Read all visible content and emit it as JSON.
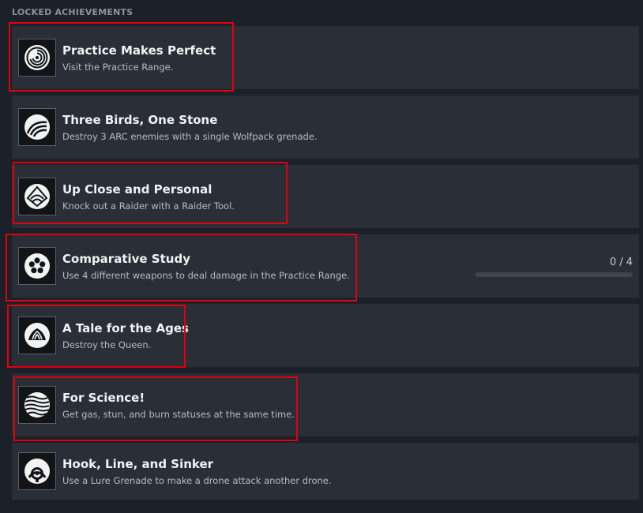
{
  "section_title": "LOCKED ACHIEVEMENTS",
  "achievements": [
    {
      "title": "Practice Makes Perfect",
      "description": "Visit the Practice Range.",
      "icon": "target-spiral-icon"
    },
    {
      "title": "Three Birds, One Stone",
      "description": "Destroy 3 ARC enemies with a single Wolfpack grenade.",
      "icon": "triple-arc-icon"
    },
    {
      "title": "Up Close and Personal",
      "description": "Knock out a Raider with a Raider Tool.",
      "icon": "raider-tool-icon"
    },
    {
      "title": "Comparative Study",
      "description": "Use 4 different weapons to deal damage in the Practice Range.",
      "icon": "weapons-wheel-icon",
      "progress_text": "0 / 4",
      "progress_fraction": 0
    },
    {
      "title": "A Tale for the Ages",
      "description": "Destroy the Queen.",
      "icon": "queen-icon"
    },
    {
      "title": "For Science!",
      "description": "Get gas, stun, and burn statuses at the same time.",
      "icon": "science-waves-icon"
    },
    {
      "title": "Hook, Line, and Sinker",
      "description": "Use a Lure Grenade to make a drone attack another drone.",
      "icon": "lure-hook-icon"
    }
  ],
  "colors": {
    "background": "#1b2029",
    "row": "#2a2e36",
    "highlight": "#e3000b",
    "progress_track": "#3f454d"
  }
}
